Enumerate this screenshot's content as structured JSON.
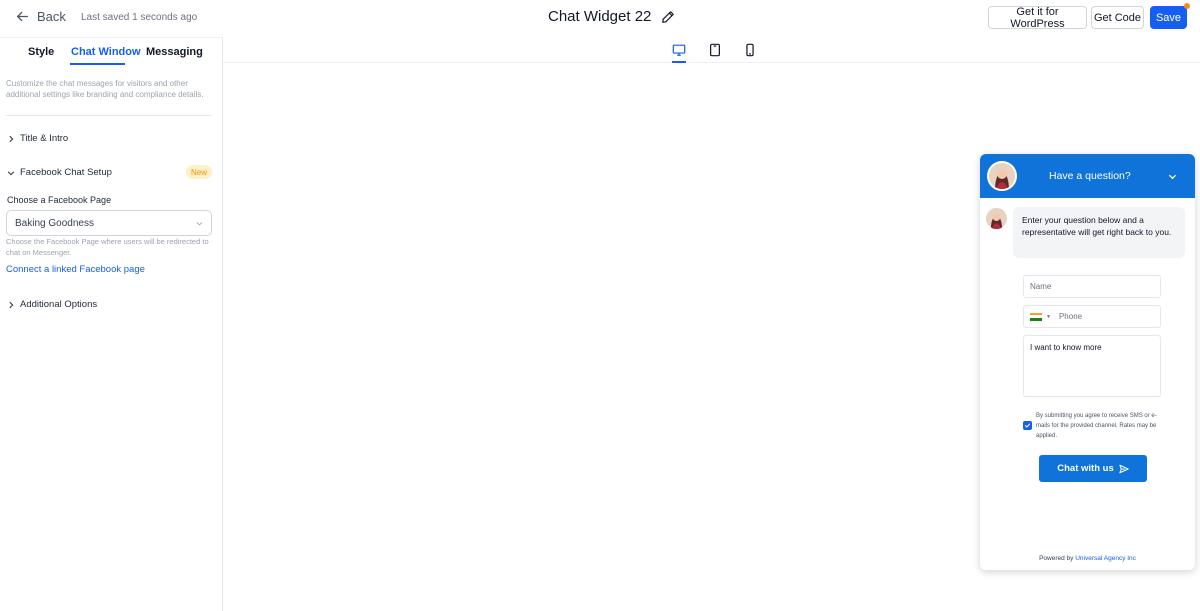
{
  "topbar": {
    "back_label": "Back",
    "saved_status": "Last saved 1 seconds ago",
    "widget_name": "Chat Widget 22",
    "wordpress_label": "Get it for WordPress",
    "get_code_label": "Get Code",
    "save_label": "Save"
  },
  "sidebar": {
    "tabs": [
      {
        "label": "Style"
      },
      {
        "label": "Chat Window",
        "active": true
      },
      {
        "label": "Messaging"
      }
    ],
    "description": "Customize the chat messages for visitors and other additional settings like branding and compliance details.",
    "sections": {
      "title_intro": "Title & Intro",
      "facebook_setup": "Facebook Chat Setup",
      "facebook_badge": "New",
      "additional_options": "Additional Options"
    },
    "facebook": {
      "page_label": "Choose a Facebook Page",
      "selected_page": "Baking Goodness",
      "help_text": "Choose the Facebook Page where users will be redirected to chat on Messenger.",
      "connect_link": "Connect a linked Facebook page"
    }
  },
  "preview": {
    "devices": [
      "desktop-icon",
      "tablet-icon",
      "mobile-icon"
    ],
    "active_device": "desktop"
  },
  "widget": {
    "header_title": "Have a question?",
    "intro_message": "Enter your question below and a representative will get right back to you.",
    "name_placeholder": "Name",
    "phone_placeholder": "Phone",
    "message_value": "I want to know more",
    "consent_text": "By submitting you agree to receive SMS or e-mails for the provided channel. Rates may be applied.",
    "consent_checked": true,
    "submit_label": "Chat with us",
    "powered_by_label": "Powered by",
    "agency_name": "Universal Agency Inc"
  },
  "colors": {
    "accent": "#155eef",
    "widget_header": "#0f73d9",
    "badge_bg": "#fef0c7",
    "badge_text": "#f79009"
  }
}
